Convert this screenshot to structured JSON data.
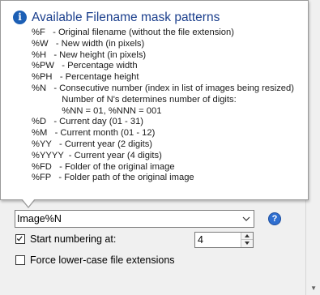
{
  "tooltip": {
    "title": "Available Filename mask patterns",
    "lines": [
      "%F   - Original filename (without the file extension)",
      "%W   - New width (in pixels)",
      "%H   - New height (in pixels)",
      "%PW   - Percentage width",
      "%PH   - Percentage height",
      "%N   - Consecutive number (index in list of images being resized)",
      "            Number of N's determines number of digits:",
      "            %NN = 01, %NNN = 001",
      "%D   - Current day (01 - 31)",
      "%M   - Current month (01 - 12)",
      "%YY   - Current year (2 digits)",
      "%YYYY  - Current year (4 digits)",
      "%FD   - Folder of the original image",
      "%FP   - Folder path of the original image"
    ]
  },
  "filename_mask": {
    "value": "Image%N"
  },
  "start_numbering": {
    "label": "Start numbering at:",
    "checked": true,
    "value": "4"
  },
  "force_lowercase": {
    "label": "Force lower-case file extensions",
    "checked": false
  },
  "colors": {
    "tooltip_title": "#1a3e8c",
    "info_icon": "#1c5fb5",
    "help_icon": "#2f6fd0",
    "window_bg": "#f0f0f0"
  },
  "icons": {
    "info": "info-icon",
    "help": "help-icon",
    "dropdown": "chevron-down-icon",
    "spin_up": "arrow-up-icon",
    "spin_down": "arrow-down-icon",
    "checkmark": "checkmark-icon"
  }
}
